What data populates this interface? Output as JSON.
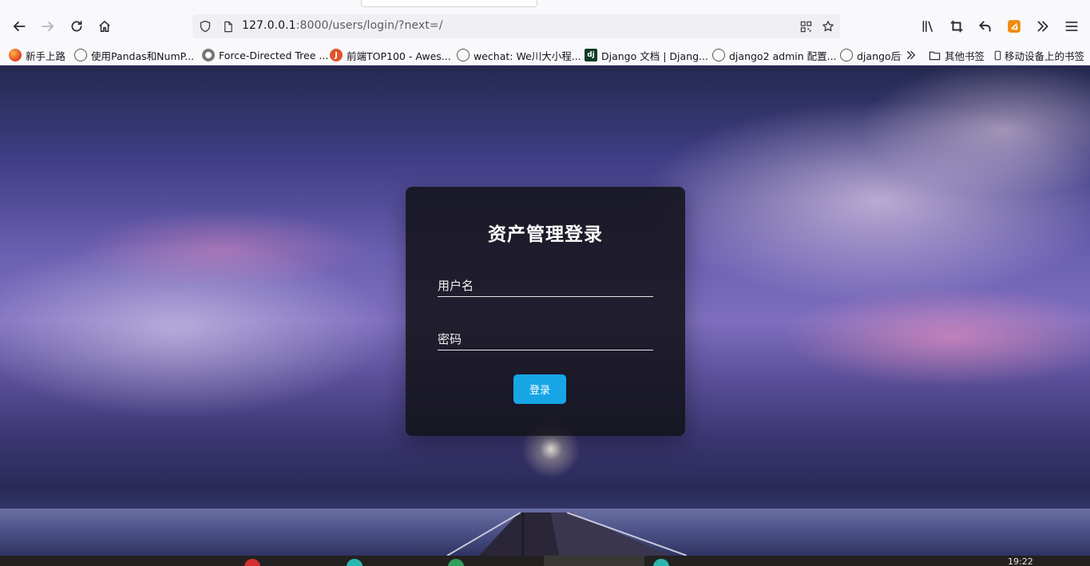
{
  "browser": {
    "url_host": "127.0.0.1",
    "url_rest": ":8000/users/login/?next=/"
  },
  "bookmarks": [
    {
      "label": "新手上路",
      "color": "#e04020"
    },
    {
      "label": "使用Pandas和NumP...",
      "color": "#555555"
    },
    {
      "label": "Force-Directed Tree ...",
      "color": "#777777"
    },
    {
      "label": "前端TOP100 - Awes...",
      "color": "#e2532c"
    },
    {
      "label": "wechat: We川大小程...",
      "color": "#555555"
    },
    {
      "label": "Django 文档 | Djang...",
      "color": "#0c3c26"
    },
    {
      "label": "django2 admin 配置...",
      "color": "#555555"
    },
    {
      "label": "django后台",
      "color": "#555555"
    }
  ],
  "other_bookmarks": "其他书签",
  "mobile_bookmarks": "移动设备上的书签",
  "login": {
    "title": "资产管理登录",
    "username_placeholder": "用户名",
    "password_placeholder": "密码",
    "submit_label": "登录",
    "button_color": "#16a6e6"
  },
  "taskbar": {
    "clock": "19:22"
  }
}
